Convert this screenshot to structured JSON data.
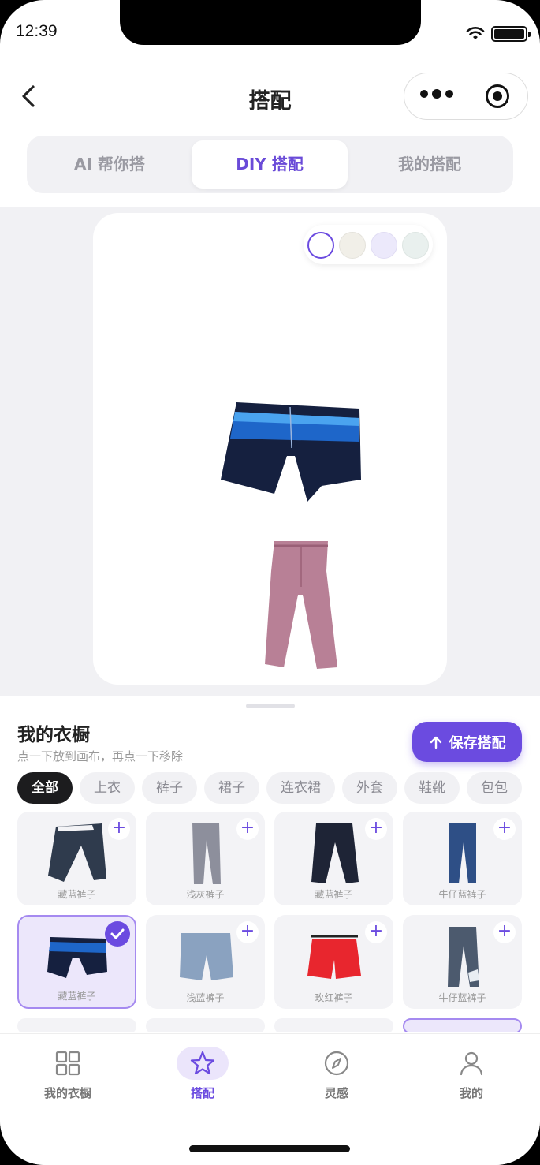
{
  "status_bar": {
    "time": "12:39"
  },
  "nav": {
    "title": "搭配"
  },
  "segments": [
    {
      "label": "AI 帮你搭",
      "active": false
    },
    {
      "label": "DIY 搭配",
      "active": true
    },
    {
      "label": "我的搭配",
      "active": false
    }
  ],
  "background_swatches": [
    "#ffffff",
    "#f1efe8",
    "#ece9fb",
    "#e9f0ee"
  ],
  "wardrobe": {
    "title": "我的衣橱",
    "subtitle": "点一下放到画布，再点一下移除",
    "save_label": "保存搭配",
    "filters": [
      "全部",
      "上衣",
      "裤子",
      "裙子",
      "连衣裙",
      "外套",
      "鞋靴",
      "包包"
    ],
    "items": [
      {
        "label": "藏蓝裤子",
        "selected": false
      },
      {
        "label": "浅灰裤子",
        "selected": false
      },
      {
        "label": "藏蓝裤子",
        "selected": false
      },
      {
        "label": "牛仔蓝裤子",
        "selected": false
      },
      {
        "label": "藏蓝裤子",
        "selected": true
      },
      {
        "label": "浅蓝裤子",
        "selected": false
      },
      {
        "label": "玫红裤子",
        "selected": false
      },
      {
        "label": "牛仔蓝裤子",
        "selected": false
      }
    ]
  },
  "tabs": [
    {
      "label": "我的衣橱",
      "icon": "grid-icon"
    },
    {
      "label": "搭配",
      "icon": "star-icon"
    },
    {
      "label": "灵感",
      "icon": "compass-icon"
    },
    {
      "label": "我的",
      "icon": "person-icon"
    }
  ],
  "colors": {
    "accent": "#6b4be0"
  }
}
